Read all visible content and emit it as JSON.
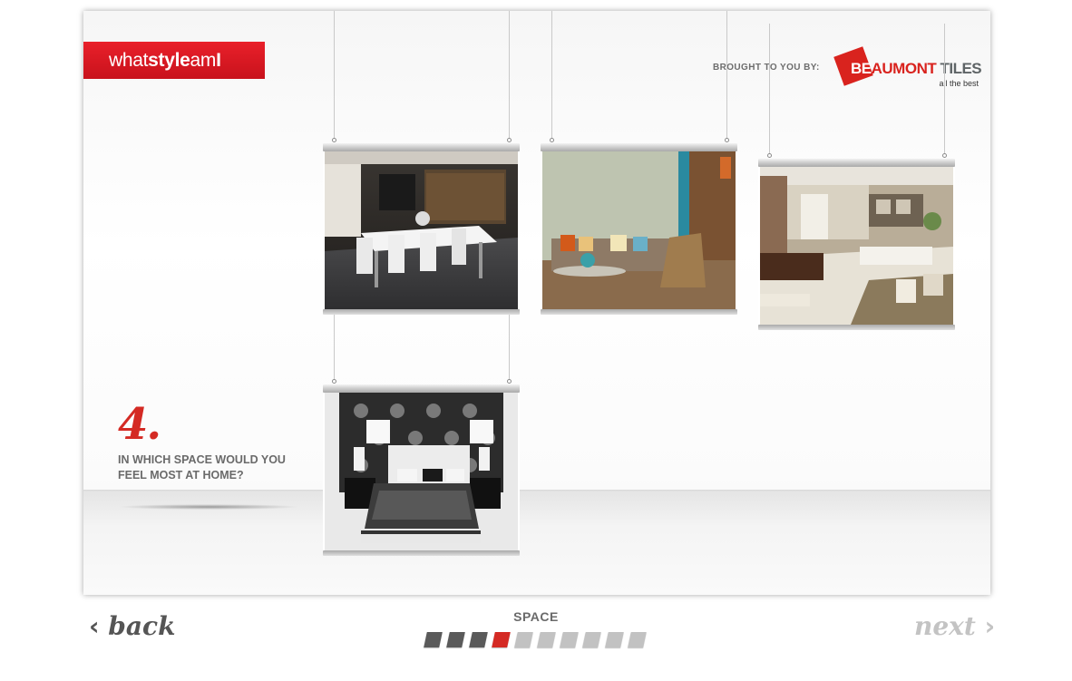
{
  "brand": {
    "pre": "what",
    "bold": "style",
    "mid": "am",
    "end": "I"
  },
  "sponsor": {
    "label": "BROUGHT TO YOU BY:",
    "logo_be": "BE",
    "logo_aumont": "AUMONT",
    "logo_tiles": " TILES",
    "tagline": "all the best",
    "brand_color": "#d9231e"
  },
  "question": {
    "number": "4.",
    "text": "IN WHICH SPACE WOULD YOU FEEL MOST AT HOME?"
  },
  "options": [
    {
      "name": "option-dining-room"
    },
    {
      "name": "option-living-room"
    },
    {
      "name": "option-open-plan-lounge"
    },
    {
      "name": "option-bedroom"
    }
  ],
  "progress": {
    "section": "SPACE",
    "current_step": 4,
    "total_steps": 10
  },
  "nav": {
    "back_label": "back",
    "next_label": "next",
    "back_icon": "chevron-left-icon",
    "next_icon": "chevron-right-icon"
  }
}
